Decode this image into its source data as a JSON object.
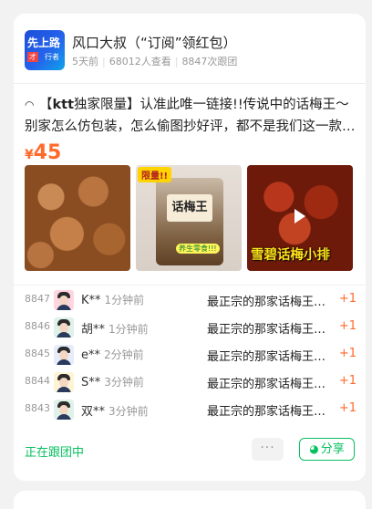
{
  "card": {
    "author_avatar_text": [
      "先上路",
      "才",
      "行者"
    ],
    "title": "风口大叔（“订阅”领红包）",
    "meta": [
      "5天前",
      "68012人查看",
      "8847次跟团"
    ],
    "description_prefix": "【",
    "description_brand": "ktt",
    "description_text": "独家限量】认准此唯一链接!!传说中的话梅王～别家怎么仿包装，怎么偷图抄好评，都不是我们这一款，我们的话梅是",
    "price_symbol": "¥",
    "price_value": "45",
    "images": [
      {
        "name": "dried-plums-photo"
      },
      {
        "name": "product-bag-photo",
        "badge": "限量!!",
        "label": "话梅王",
        "sticker": "养生零食!!!"
      },
      {
        "name": "video-thumbnail",
        "caption": "雪碧话梅小排"
      }
    ],
    "orders": [
      {
        "num": "8847",
        "name": "K**",
        "time": "1分钟前",
        "product": "最正宗的那家话梅王…",
        "qty": "+1",
        "avatar_color": "#ffd6e0"
      },
      {
        "num": "8846",
        "name": "胡**",
        "time": "1分钟前",
        "product": "最正宗的那家话梅王…",
        "qty": "+1",
        "avatar_color": "#dff2ea"
      },
      {
        "num": "8845",
        "name": "e**",
        "time": "2分钟前",
        "product": "最正宗的那家话梅王…",
        "qty": "+1",
        "avatar_color": "#e6ecfb"
      },
      {
        "num": "8844",
        "name": "S**",
        "time": "3分钟前",
        "product": "最正宗的那家话梅王…",
        "qty": "+1",
        "avatar_color": "#fff3d6"
      },
      {
        "num": "8843",
        "name": "双**",
        "time": "3分钟前",
        "product": "最正宗的那家话梅王…",
        "qty": "+1",
        "avatar_color": "#dff2ea"
      }
    ],
    "status": "正在跟团中",
    "more_label": "···",
    "share_label": "分享",
    "accent_color": "#07c160",
    "price_color": "#ff6a2b"
  }
}
